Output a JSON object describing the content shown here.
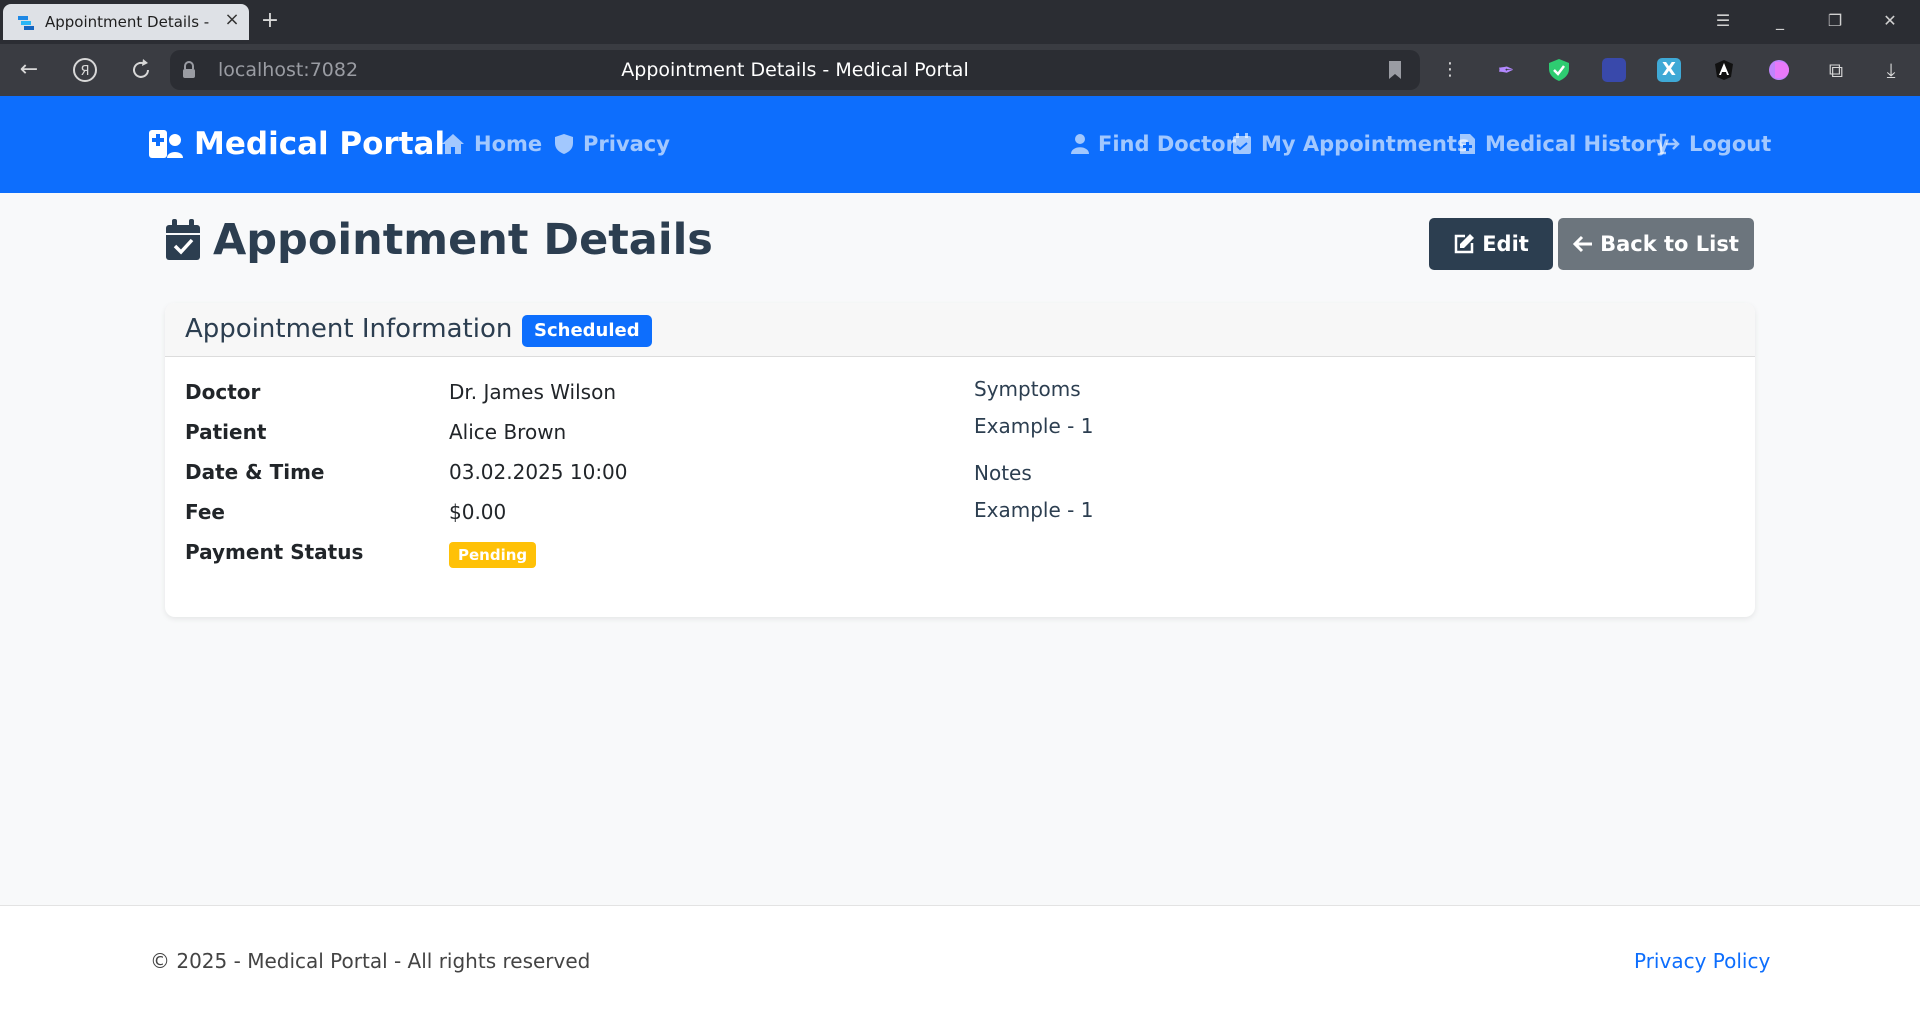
{
  "browser": {
    "tab_title": "Appointment Details - M",
    "url": "localhost:7082",
    "page_title": "Appointment Details - Medical Portal",
    "icons": {
      "back": "arrow-left-icon",
      "yandex": "yandex-icon",
      "reload": "reload-icon",
      "lock": "lock-icon",
      "bookmark": "bookmark-icon",
      "menu": "hamburger-icon"
    }
  },
  "navbar": {
    "brand": "Medical Portal",
    "links": {
      "home": "Home",
      "privacy": "Privacy",
      "find_doctor": "Find Doctor",
      "my_appointments": "My Appointments",
      "medical_history": "Medical History",
      "logout": "Logout"
    },
    "colors": {
      "background": "#0d6efd"
    }
  },
  "page": {
    "title": "Appointment Details",
    "buttons": {
      "edit": "Edit",
      "back": "Back to List"
    }
  },
  "card": {
    "header": "Appointment Information",
    "status_badge": "Scheduled",
    "details": {
      "doctor": {
        "label": "Doctor",
        "value": "Dr. James Wilson"
      },
      "patient": {
        "label": "Patient",
        "value": "Alice Brown"
      },
      "datetime": {
        "label": "Date & Time",
        "value": "03.02.2025 10:00"
      },
      "fee": {
        "label": "Fee",
        "value": "$0.00"
      },
      "payment_status": {
        "label": "Payment Status",
        "value": "Pending"
      }
    },
    "symptoms": {
      "label": "Symptoms",
      "value": "Example - 1"
    },
    "notes": {
      "label": "Notes",
      "value": "Example - 1"
    },
    "colors": {
      "scheduled": "#0d6efd",
      "pending": "#ffc107"
    }
  },
  "footer": {
    "copyright": "© 2025 - Medical Portal - All rights reserved",
    "privacy_link": "Privacy Policy"
  }
}
